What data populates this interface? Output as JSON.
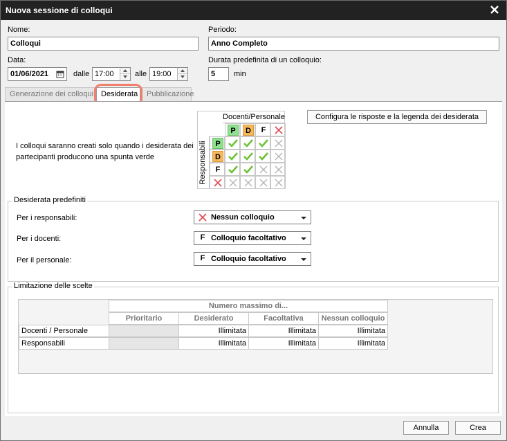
{
  "window": {
    "title": "Nuova sessione di colloqui"
  },
  "form": {
    "name_label": "Nome:",
    "name_value": "Colloqui",
    "period_label": "Periodo:",
    "period_value": "Anno Completo",
    "date_label": "Data:",
    "date_value": "01/06/2021",
    "from_label": "dalle",
    "from_value": "17:00",
    "to_label": "alle",
    "to_value": "19:00",
    "duration_label": "Durata predefinita di un colloquio:",
    "duration_value": "5",
    "duration_unit": "min"
  },
  "tabs": [
    {
      "label": "Generazione dei colloqui"
    },
    {
      "label": "Desiderata"
    },
    {
      "label": "Pubblicazione"
    }
  ],
  "desiderata": {
    "description": "I colloqui saranno creati solo quando i desiderata dei partecipanti producono una spunta verde",
    "matrix_col_header": "Docenti/Personale",
    "matrix_row_header": "Responsabili",
    "letters": [
      "P",
      "D",
      "F"
    ],
    "configure_button": "Configura le risposte e la legenda dei desiderata",
    "matrix": [
      [
        "check",
        "check",
        "check",
        "cross"
      ],
      [
        "check",
        "check",
        "check",
        "cross"
      ],
      [
        "check",
        "check",
        "cross",
        "cross"
      ],
      [
        "cross",
        "cross",
        "cross",
        "cross"
      ]
    ],
    "colors": {
      "P": "#8fe08f",
      "D": "#f5b85c",
      "check": "#6cc236",
      "cross_active": "#e0505a",
      "cross": "#b5b5b5"
    }
  },
  "defaults": {
    "legend": "Desiderata predefiniti",
    "rows": [
      {
        "label": "Per i responsabili:",
        "icon": "cross",
        "value": "Nessun colloquio"
      },
      {
        "label": "Per i docenti:",
        "icon": "F",
        "value": "Colloquio facoltativo"
      },
      {
        "label": "Per il personale:",
        "icon": "F",
        "value": "Colloquio facoltativo"
      }
    ]
  },
  "limits": {
    "legend": "Limitazione delle scelte",
    "group_header": "Numero massimo di...",
    "columns": [
      "Prioritario",
      "Desiderato",
      "Facoltativa",
      "Nessun colloquio"
    ],
    "rows": [
      {
        "label": "Docenti / Personale",
        "values": [
          "",
          "Illimitata",
          "Illimitata",
          "Illimitata"
        ]
      },
      {
        "label": "Responsabili",
        "values": [
          "",
          "Illimitata",
          "Illimitata",
          "Illimitata"
        ]
      }
    ]
  },
  "footer": {
    "cancel_label": "Annulla",
    "create_label": "Crea"
  }
}
